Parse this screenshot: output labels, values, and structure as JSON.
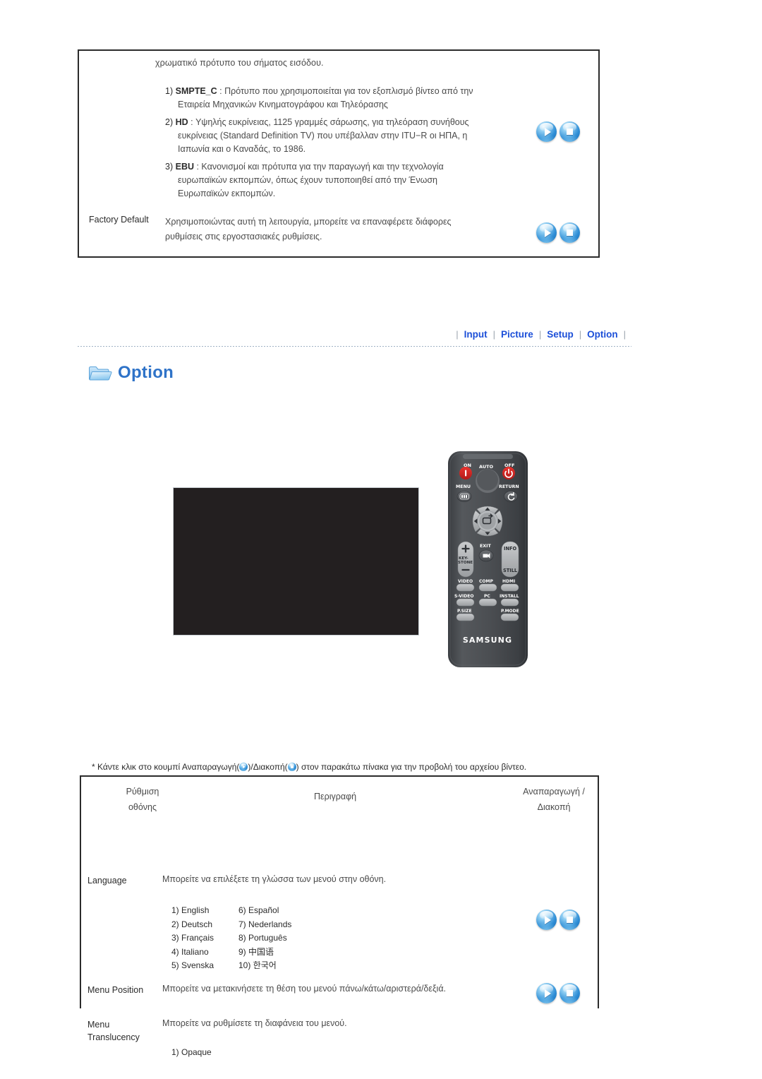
{
  "top_section": {
    "intro": "χρωματικό πρότυπο του σήματος εισόδου.",
    "items": [
      {
        "index": "1)",
        "keyword": "SMPTE_C",
        "line1": " : Πρότυπο που χρησιμοποιείται για τον εξοπλισμό βίντεο από την",
        "line2": "Εταιρεία Μηχανικών Κινηματογράφου και Τηλεόρασης",
        "line3": ""
      },
      {
        "index": "2)",
        "keyword": "HD",
        "line1": " : Υψηλής ευκρίνειας, 1125 γραμμές σάρωσης, για τηλεόραση συνήθους",
        "line2": "ευκρίνειας (Standard Definition TV) που υπέβαλλαν στην ITU−R οι ΗΠΑ, η",
        "line3": "Ιαπωνία και ο Καναδάς, το 1986."
      },
      {
        "index": "3)",
        "keyword": "EBU",
        "line1": " : Κανονισμοί και πρότυπα για την παραγωγή και την τεχνολογία",
        "line2": "ευρωπαϊκών εκπομπών, όπως έχουν τυποποιηθεί από την Ένωση",
        "line3": "Ευρωπαϊκών εκπομπών."
      }
    ],
    "factory_default": {
      "label": "Factory Default",
      "line1": "Χρησιμοποιώντας αυτή τη λειτουργία, μπορείτε να επαναφέρετε διάφορες",
      "line2": "ρυθμίσεις στις εργοστασιακές ρυθμίσεις."
    }
  },
  "nav": {
    "separator": "|",
    "tabs": [
      {
        "label": "Input"
      },
      {
        "label": "Picture"
      },
      {
        "label": "Setup"
      },
      {
        "label": "Option"
      }
    ]
  },
  "option_header": {
    "title": "Option",
    "icon": "folder-icon"
  },
  "media": {
    "video_panel_name": "video-player",
    "remote": {
      "brand": "SAMSUNG",
      "on": "ON",
      "off": "OFF",
      "auto": "AUTO",
      "menu": "MENU",
      "return": "RETURN",
      "keystone_top": "KEY-",
      "keystone_bottom": "STONE",
      "exit": "EXIT",
      "info": "INFO",
      "still": "STILL",
      "video": "VIDEO",
      "comp": "COMP",
      "hdmi": "HDMI",
      "svideo": "S-VIDEO",
      "pc": "PC",
      "install": "INSTALL",
      "psize": "P.SIZE",
      "pmode": "P.MODE"
    }
  },
  "play_note": {
    "prefix": "* Κάντε κλικ στο κουμπί Αναπαραγωγή(",
    "middle": ")/Διακοπή(",
    "suffix": ") στον παρακάτω πίνακα για την προβολή του αρχείου βίντεο."
  },
  "table": {
    "headers": {
      "setting_line1": "Ρύθμιση",
      "setting_line2": "οθόνης",
      "description": "Περιγραφή",
      "play_line1": "Αναπαραγωγή /",
      "play_line2": "Διακοπή"
    },
    "rows": [
      {
        "label": "Language",
        "label2": "",
        "description": "Μπορείτε να επιλέξετε τη γλώσσα των μενού στην οθόνη.",
        "options_left": [
          "1) English",
          "2) Deutsch",
          "3) Français",
          "4) Italiano",
          "5) Svenska"
        ],
        "options_right": [
          "6) Español",
          "7) Nederlands",
          "8) Português",
          "9) 中国语",
          "10) 한국어"
        ]
      },
      {
        "label": "Menu Position",
        "label2": "",
        "description": "Μπορείτε να μετακινήσετε τη θέση του μενού πάνω/κάτω/αριστερά/δεξιά.",
        "options_left": [],
        "options_right": []
      },
      {
        "label": "Menu",
        "label2": "Translucency",
        "description": "Μπορείτε να ρυθμίσετε τη διαφάνεια του μενού.",
        "options_left": [
          "1) Opaque"
        ],
        "options_right": []
      }
    ]
  },
  "colors": {
    "accent_blue": "#1c4fd8",
    "title_blue": "#2f73c8",
    "button_blue": "#2f8ed6",
    "border_dark": "#2b2b2b",
    "video_bg": "#231f20"
  }
}
